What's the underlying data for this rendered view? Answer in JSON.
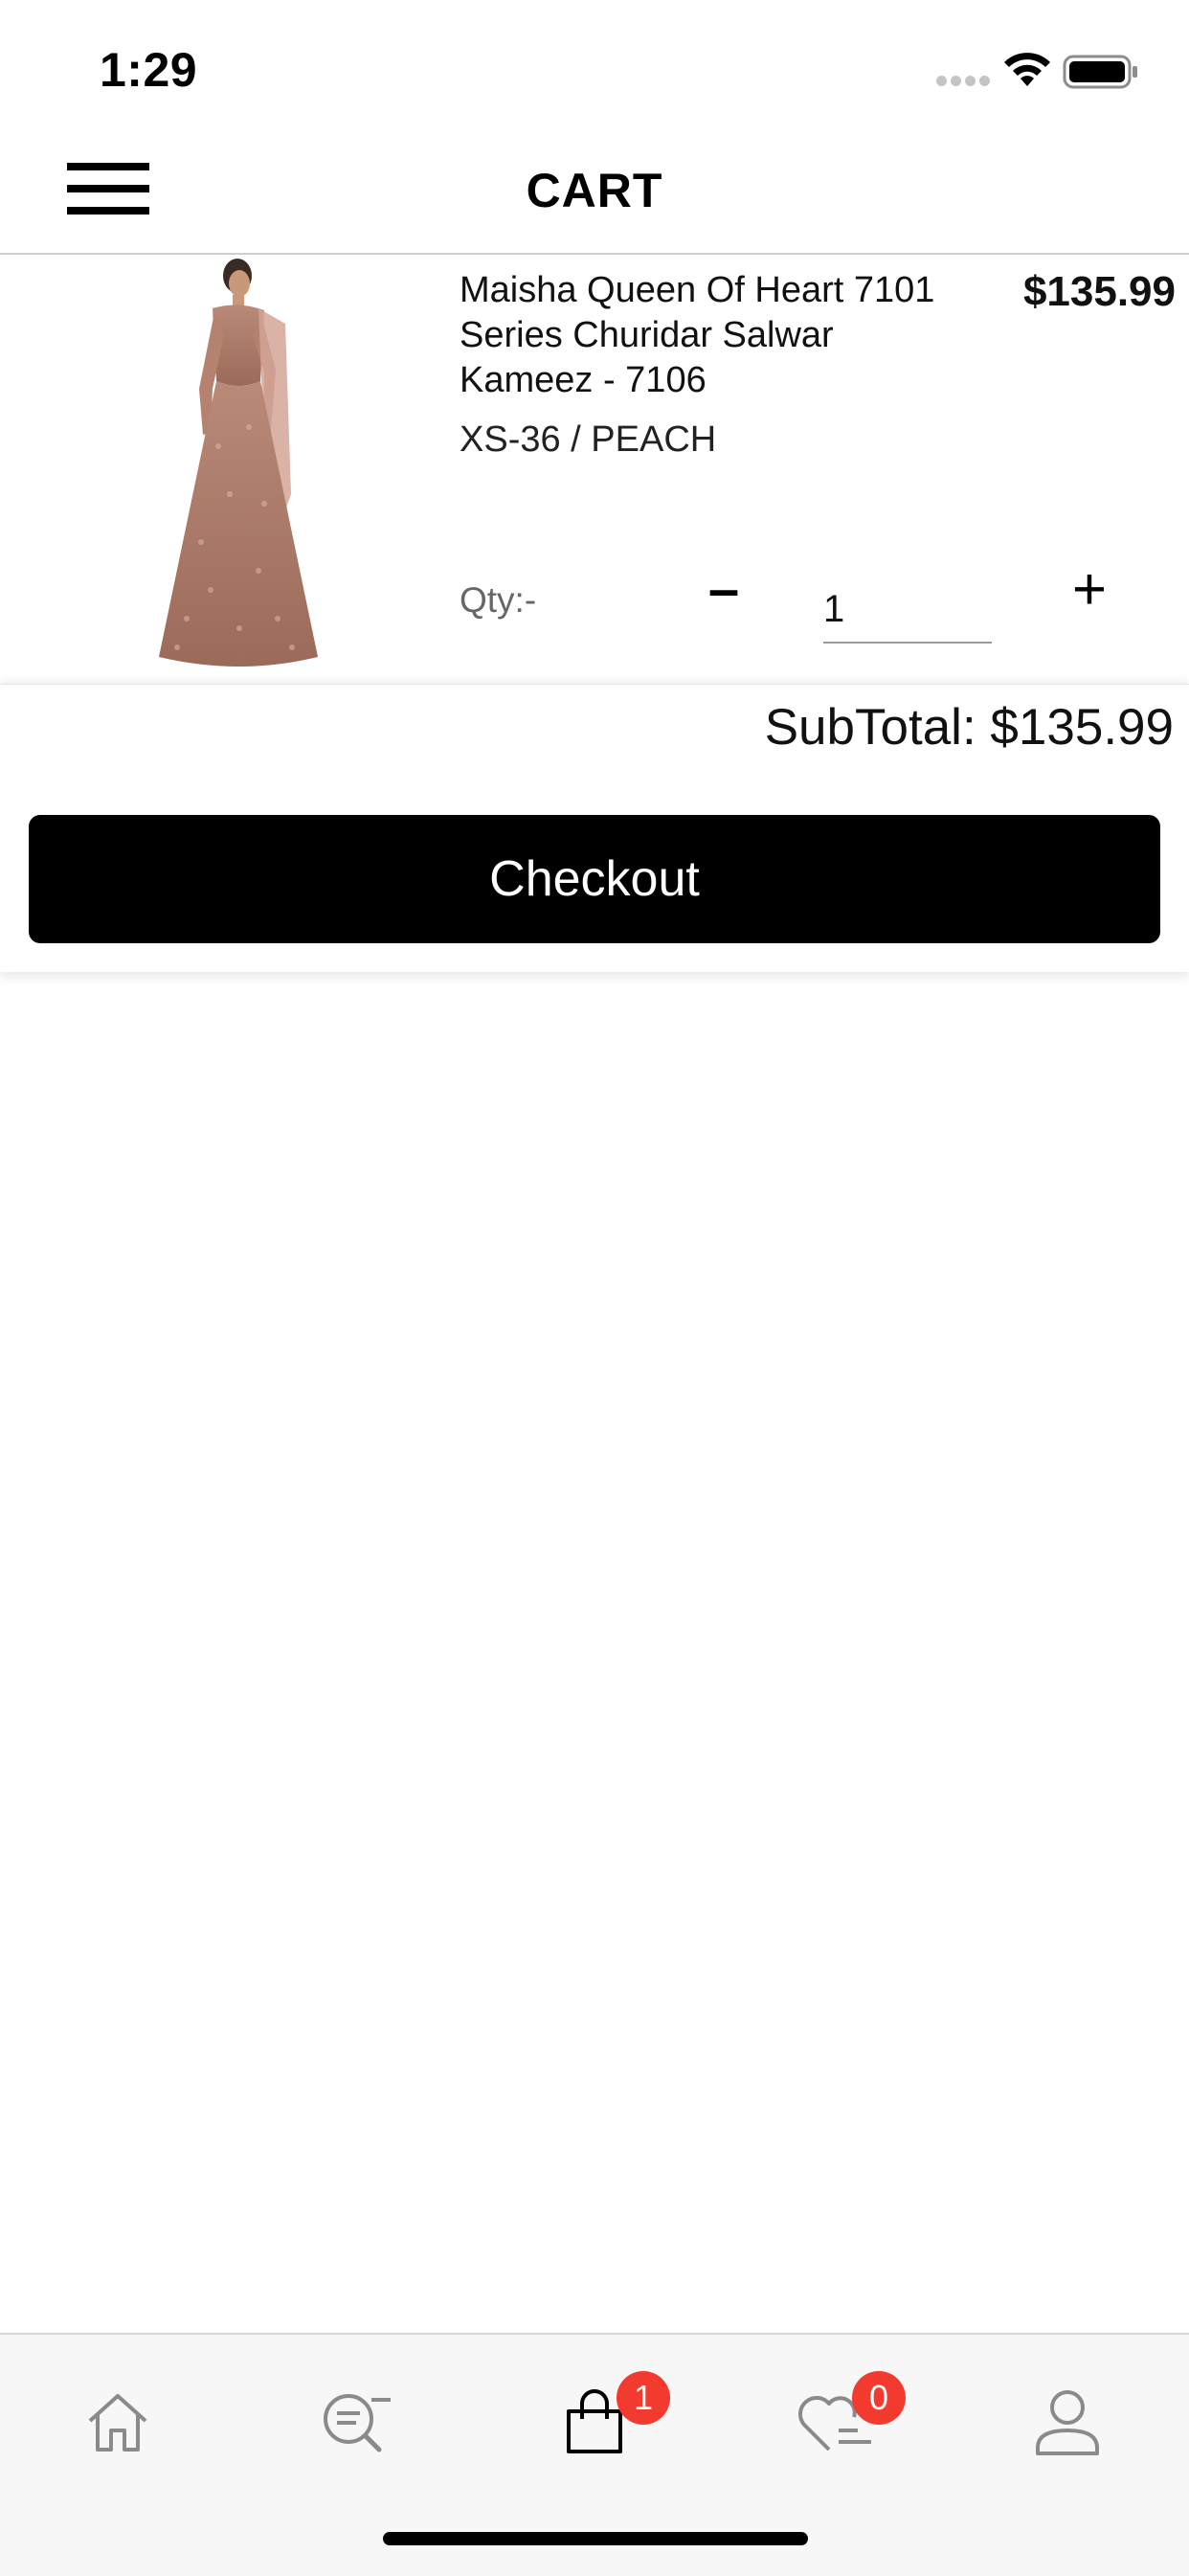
{
  "status_bar": {
    "time": "1:29"
  },
  "nav": {
    "title": "CART",
    "menu_icon": "hamburger-icon"
  },
  "cart_item": {
    "name": "Maisha Queen Of Heart 7101 Series Churidar Salwar Kameez - 7106",
    "price": "$135.99",
    "variant": "XS-36 / PEACH",
    "qty_label": "Qty:-",
    "qty_minus": "–",
    "qty_value": "1",
    "qty_plus": "+",
    "image_icon": "product-dress-image"
  },
  "summary": {
    "subtotal": "SubTotal: $135.99",
    "checkout_label": "Checkout"
  },
  "tab_bar": {
    "items": [
      {
        "name": "home",
        "icon": "home-icon"
      },
      {
        "name": "search",
        "icon": "search-icon"
      },
      {
        "name": "cart",
        "icon": "shopping-bag-icon",
        "badge": "1"
      },
      {
        "name": "wishlist",
        "icon": "heart-list-icon",
        "badge": "0"
      },
      {
        "name": "account",
        "icon": "user-icon"
      }
    ]
  },
  "colors": {
    "badge": "#f23a2f",
    "button": "#000000",
    "tab_bar_bg": "#f7f7f7",
    "inactive_icon": "#8a8a8a",
    "active_icon": "#000000"
  }
}
